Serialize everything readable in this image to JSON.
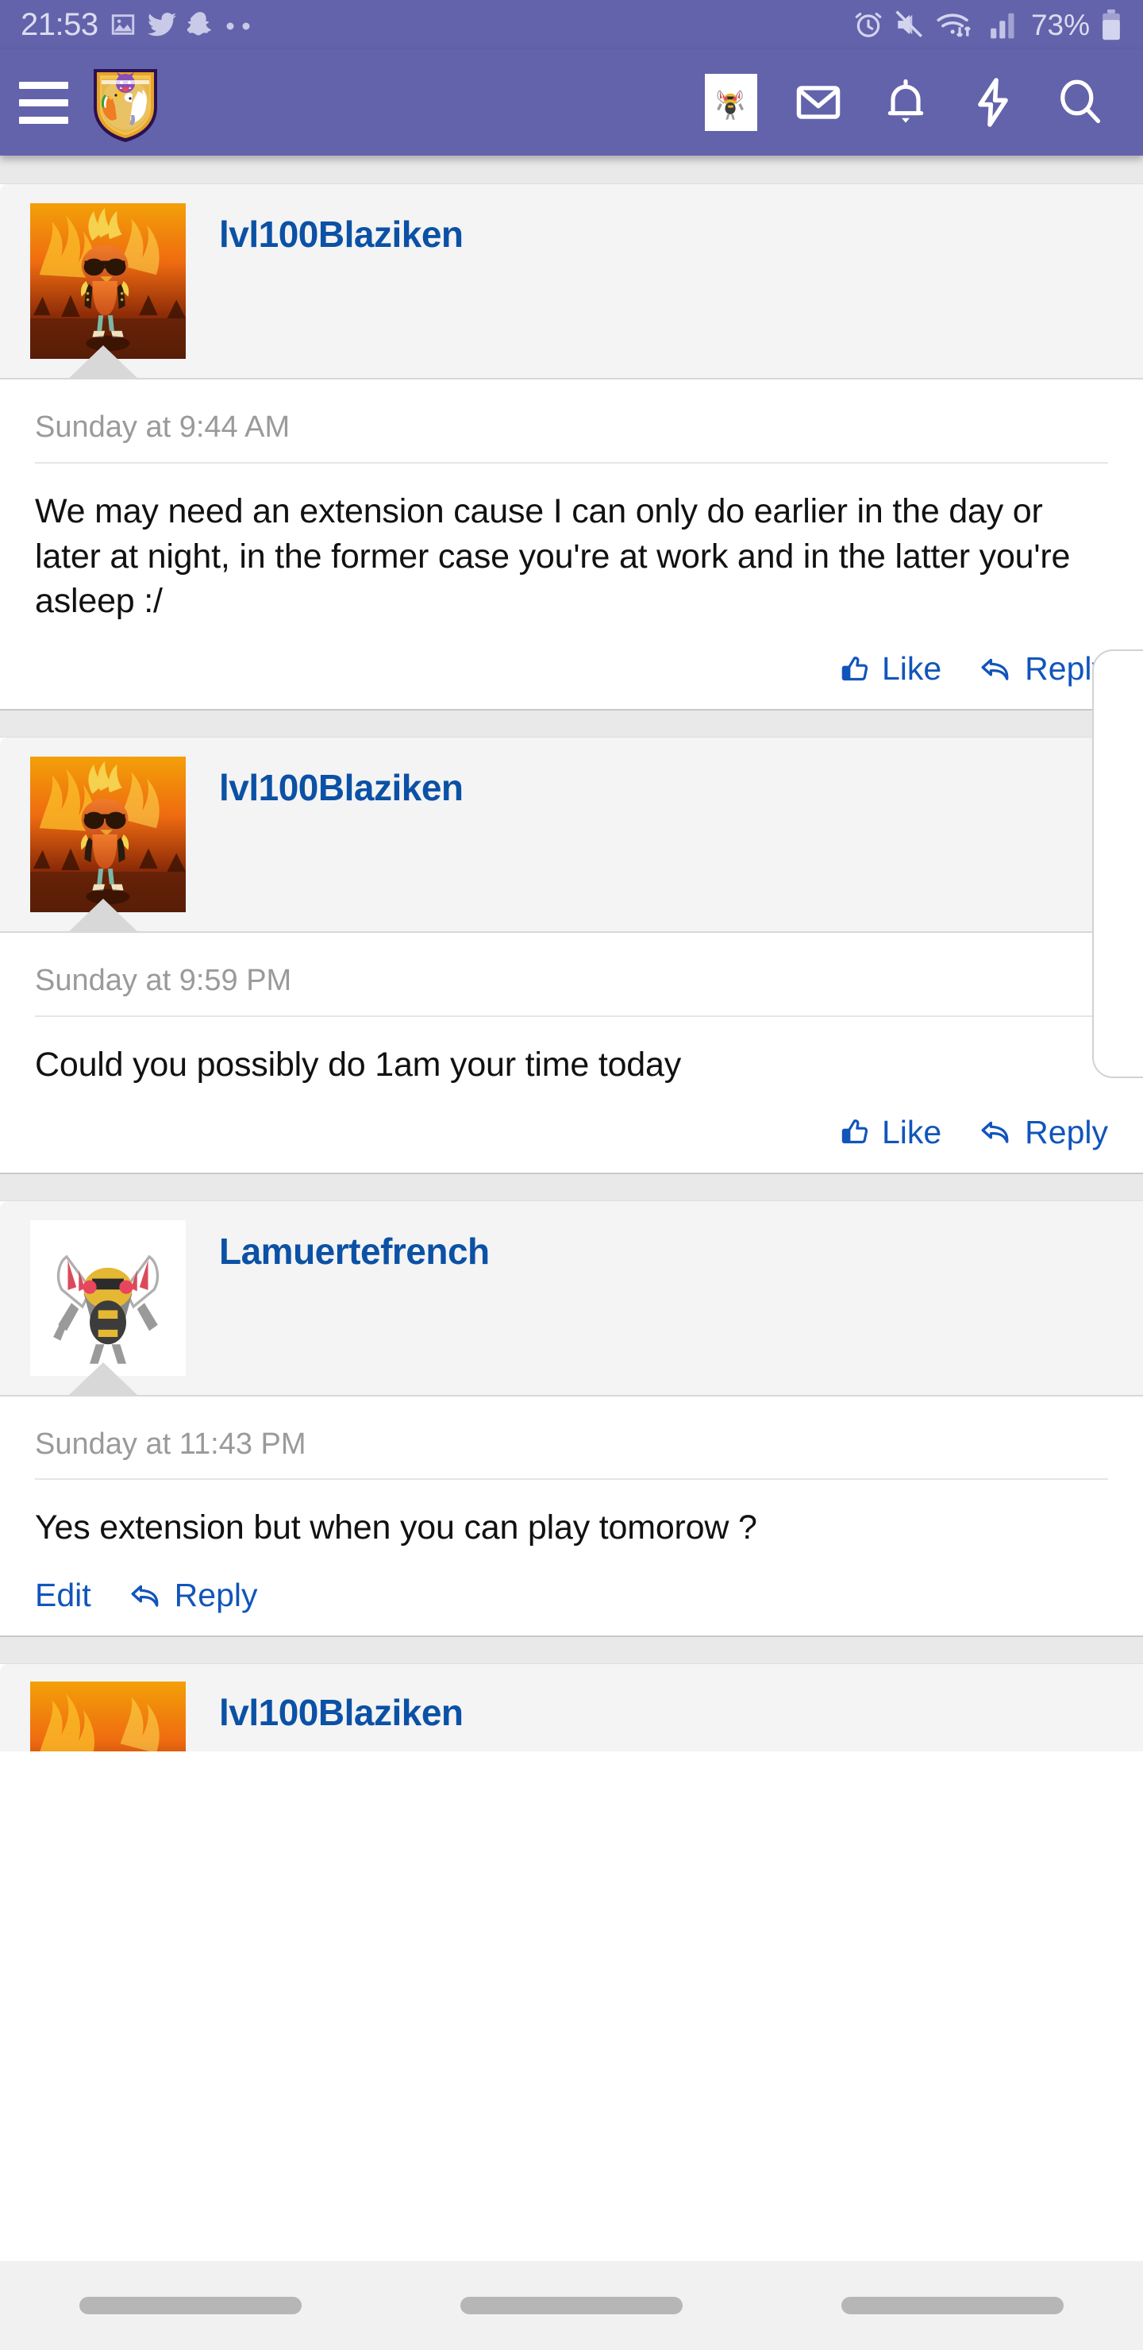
{
  "status_bar": {
    "time": "21:53",
    "battery_percent": "73%",
    "left_icons": [
      "photo-icon",
      "twitter-icon",
      "snapchat-icon",
      "more-dots-icon"
    ],
    "right_icons": [
      "alarm-icon",
      "volume-muted-icon",
      "wifi-icon",
      "signal-icon",
      "battery-icon"
    ],
    "background_color": "#6363ac",
    "text_color": "#dcdcf0"
  },
  "header": {
    "menu_icon": "hamburger-menu-icon",
    "logo_icon": "forum-shield-logo",
    "actions": [
      {
        "name": "user-avatar",
        "icon": "beedrill-avatar-icon"
      },
      {
        "name": "inbox",
        "icon": "envelope-icon"
      },
      {
        "name": "alerts",
        "icon": "bell-icon"
      },
      {
        "name": "whats-new",
        "icon": "lightning-bolt-icon"
      },
      {
        "name": "search",
        "icon": "search-icon"
      }
    ],
    "background_color": "#6363ac"
  },
  "theme": {
    "link_color": "#1155bb",
    "username_color": "#0b51a5",
    "date_color": "#9a9a9a",
    "post_header_bg": "#f4f4f4",
    "gap_band_bg": "#e9e9e9"
  },
  "thread": {
    "posts": [
      {
        "username": "lvl100Blaziken",
        "avatar": "blaziken-avatar",
        "date": "Sunday at 9:44 AM",
        "message": "We may need an extension cause I can only do earlier in the day or later at night, in the former case you're at work and in the latter you're asleep :/",
        "actions": [
          {
            "name": "like-button",
            "label": "Like",
            "icon": "thumbs-up-icon",
            "align": "right"
          },
          {
            "name": "reply-button",
            "label": "Reply",
            "icon": "reply-arrow-icon",
            "align": "right"
          }
        ]
      },
      {
        "username": "lvl100Blaziken",
        "avatar": "blaziken-avatar",
        "date": "Sunday at 9:59 PM",
        "message": "Could you possibly do 1am your time today",
        "actions": [
          {
            "name": "like-button",
            "label": "Like",
            "icon": "thumbs-up-icon",
            "align": "right"
          },
          {
            "name": "reply-button",
            "label": "Reply",
            "icon": "reply-arrow-icon",
            "align": "right"
          }
        ]
      },
      {
        "username": "Lamuertefrench",
        "avatar": "beedrill-avatar",
        "date": "Sunday at 11:43 PM",
        "message": "Yes extension but when you can play tomorow ?",
        "actions": [
          {
            "name": "edit-button",
            "label": "Edit",
            "icon": "",
            "align": "left"
          },
          {
            "name": "reply-button",
            "label": "Reply",
            "icon": "reply-arrow-icon",
            "align": "right"
          }
        ]
      }
    ],
    "partial_post": {
      "username": "lvl100Blaziken",
      "avatar": "blaziken-avatar"
    }
  },
  "navbar": {
    "items": [
      "recent-apps-button",
      "home-button",
      "back-button"
    ]
  }
}
